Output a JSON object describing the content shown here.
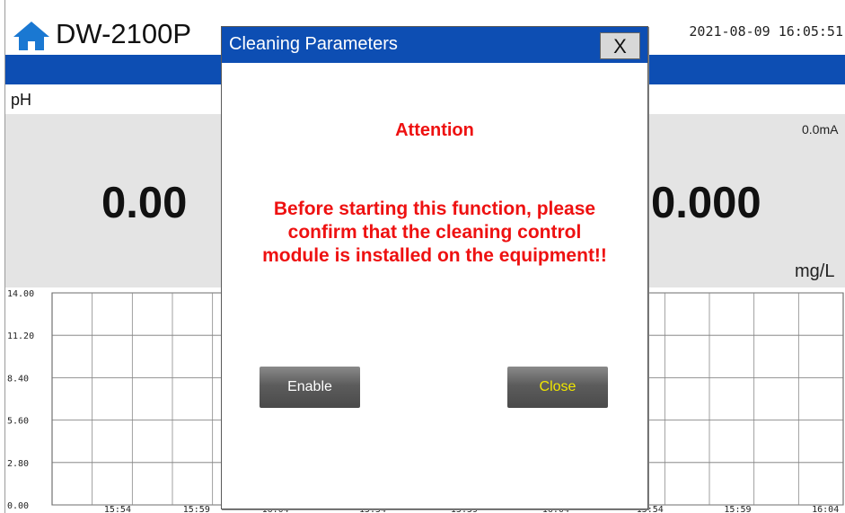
{
  "header": {
    "app_title": "DW-2100P",
    "datetime": "2021-08-09 16:05:51"
  },
  "panels": {
    "ph_label": "pH",
    "ph_value": "0.00",
    "right_value": "0.000",
    "right_current": "0.0mA",
    "right_unit": "mg/L"
  },
  "chart_data": {
    "type": "line",
    "y_ticks": [
      "14.00",
      "11.20",
      "8.40",
      "5.60",
      "2.80",
      "0.00"
    ],
    "x_ticks": [
      "15:54",
      "15:59",
      "16:04"
    ],
    "ylim": [
      0,
      14
    ],
    "grid": true,
    "series": []
  },
  "dialog": {
    "title": "Cleaning Parameters",
    "close_label": "X",
    "attention": "Attention",
    "warning_line1": "Before starting this function, please",
    "warning_line2": "confirm that the cleaning control",
    "warning_line3": "module is installed on the equipment!!",
    "enable_label": "Enable",
    "close_button_label": "Close"
  },
  "icons": {
    "home": "home-icon"
  },
  "colors": {
    "accent": "#0d4eb3",
    "warning": "#ee1111",
    "close_text": "#f0e600"
  }
}
